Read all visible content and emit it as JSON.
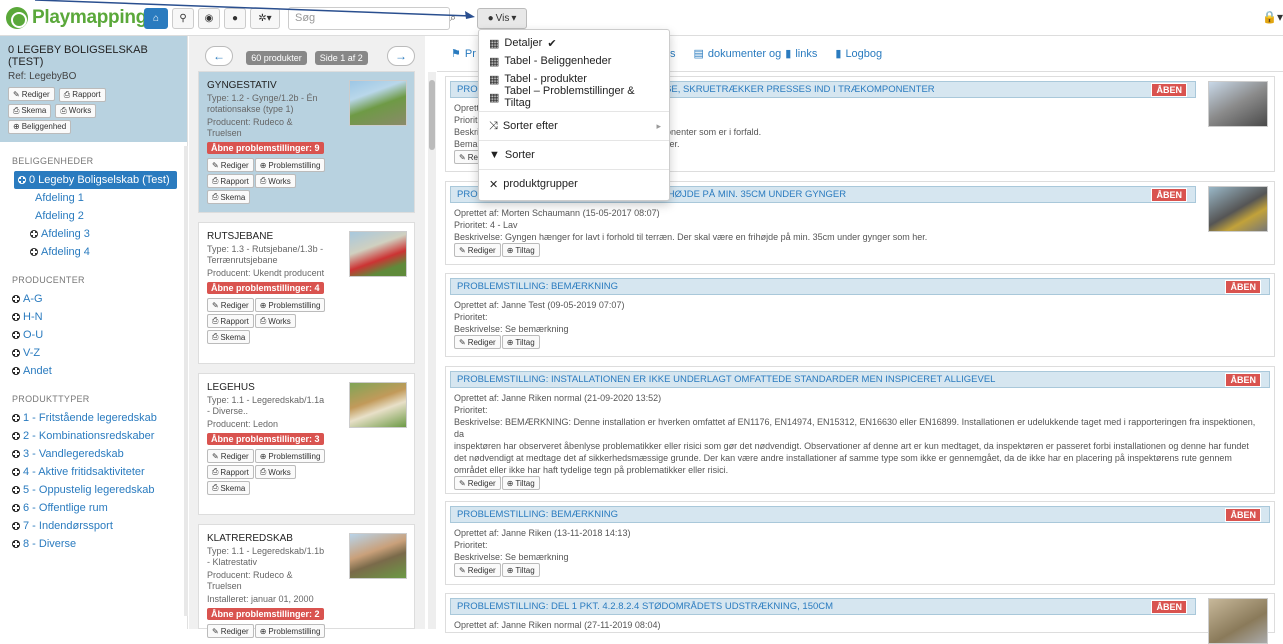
{
  "navbar": {
    "logo": "Playmapping",
    "search_placeholder": "Søg",
    "vis_label": "Vis"
  },
  "sidebar": {
    "title": "0 LEGEBY BOLIGSELSKAB (TEST)",
    "ref": "Ref: LegebyBO",
    "buttons": [
      "Rediger",
      "Rapport",
      "Skema",
      "Works",
      "Beliggenhed"
    ],
    "sec_beliggenheder": "BELIGGENHEDER",
    "locations": [
      "0 Legeby Boligselskab (Test)",
      "Afdeling 1",
      "Afdeling 2",
      "Afdeling 3",
      "Afdeling 4"
    ],
    "sec_producenter": "PRODUCENTER",
    "producers": [
      "A-G",
      "H-N",
      "O-U",
      "V-Z",
      "Andet"
    ],
    "sec_produkttyper": "PRODUKTTYPER",
    "types": [
      "1 - Fritstående legeredskab",
      "2 - Kombinationsredskaber",
      "3 - Vandlegeredskab",
      "4 - Aktive fritidsaktiviteter",
      "5 - Oppustelig legeredskab",
      "6 - Offentlige rum",
      "7 - Indendørssport",
      "8 - Diverse"
    ]
  },
  "middle": {
    "count_pill": "60 produkter",
    "page_pill": "Side 1 af 2",
    "cards": [
      {
        "title": "GYNGESTATIV",
        "lines": [
          "Type: 1.2 - Gynge/1.2b - Én rotationsakse (type 1)",
          "Producent: Rudeco & Truelsen"
        ],
        "badge": "Åbne problemstillinger: 9"
      },
      {
        "title": "RUTSJEBANE",
        "lines": [
          "Type: 1.3 - Rutsjebane/1.3b - Terrænrutsjebane",
          "Producent: Ukendt producent"
        ],
        "badge": "Åbne problemstillinger: 4"
      },
      {
        "title": "LEGEHUS",
        "lines": [
          "Type: 1.1 - Legeredskab/1.1a - Diverse..",
          "Producent: Ledon"
        ],
        "badge": "Åbne problemstillinger: 3"
      },
      {
        "title": "KLATREREDSKAB",
        "lines": [
          "Type: 1.1 - Legeredskab/1.1b - Klatrestativ",
          "Producent: Rudeco & Truelsen",
          "Installeret: januar 01, 2000"
        ],
        "badge": "Åbne problemstillinger: 2"
      }
    ],
    "btn_rediger": "Rediger",
    "btn_problem": "Problemstilling",
    "btn_rapport": "Rapport",
    "btn_works": "Works",
    "btn_skema": "Skema"
  },
  "right": {
    "tab_pr": "Pr",
    "tab_os": "os",
    "tab_dok": "dokumenter og",
    "tab_links": "links",
    "tab_log": "Logbog",
    "aben": "ÅBEN",
    "btn_rediger": "Rediger",
    "btn_tiltag": "Tiltag",
    "problems": [
      {
        "head": "PROB",
        "head_tail": "OLDELSE, SKRUETRÆKKER PRESSES IND I TRÆKOMPONENTER",
        "lines": [
          "Oprett",
          "Priorit",
          "Beskri                                                                ekomponenter som er i forfald.",
          "Bema                                                                    erligger."
        ]
      },
      {
        "head": "PROB",
        "head_tail": "DE, FRIHØJDE PÅ MIN. 35CM UNDER GYNGER",
        "lines": [
          "Oprettet af: Morten Schaumann (15-05-2017 08:07)",
          "Prioritet: 4 - Lav",
          "Beskrivelse: Gyngen hænger for lavt i forhold til terræn. Der skal være en frihøjde på min. 35cm under gynger som her."
        ]
      },
      {
        "head": "PROBLEMSTILLING: BEMÆRKNING",
        "head_tail": "",
        "lines": [
          "Oprettet af: Janne Test (09-05-2019 07:07)",
          "Prioritet:",
          "Beskrivelse: Se bemærkning"
        ]
      },
      {
        "head": "PROBLEMSTILLING: INSTALLATIONEN ER IKKE UNDERLAGT OMFATTEDE STANDARDER MEN INSPICERET ALLIGEVEL",
        "head_tail": "",
        "lines": [
          "Oprettet af: Janne Riken normal (21-09-2020 13:52)",
          "Prioritet:",
          "Beskrivelse: BEMÆRKNING: Denne installation er hverken omfattet af EN1176, EN14974, EN15312, EN16630 eller EN16899. Installationen er udelukkende taget med i rapporteringen fra inspektionen, da",
          "inspektøren har observeret åbenlyse problematikker eller risici som gør det nødvendigt. Observationer af denne art er kun medtaget, da inspektøren er passeret forbi installationen og denne har fundet",
          "det nødvendigt at medtage det af sikkerhedsmæssige grunde. Der kan være andre installationer af samme type som ikke er gennemgået, da de ikke har en placering på inspektørens rute gennem",
          "området eller ikke har haft tydelige tegn på problematikker eller risici."
        ]
      },
      {
        "head": "PROBLEMSTILLING: BEMÆRKNING",
        "head_tail": "",
        "lines": [
          "Oprettet af: Janne Riken (13-11-2018 14:13)",
          "Prioritet:",
          "Beskrivelse: Se bemærkning"
        ]
      },
      {
        "head": "PROBLEMSTILLING: DEL 1 PKT. 4.2.8.2.4 STØDOMRÅDETS UDSTRÆKNING, 150CM",
        "head_tail": "",
        "lines": [
          "Oprettet af: Janne Riken normal (27-11-2019 08:04)"
        ]
      }
    ]
  },
  "dropdown": {
    "items": [
      "Detaljer",
      "Tabel - Beliggenheder",
      "Tabel - produkter",
      "Tabel – Problemstillinger & Tiltag",
      "Sorter efter",
      "Sorter",
      "produktgrupper"
    ],
    "check": "✔"
  }
}
